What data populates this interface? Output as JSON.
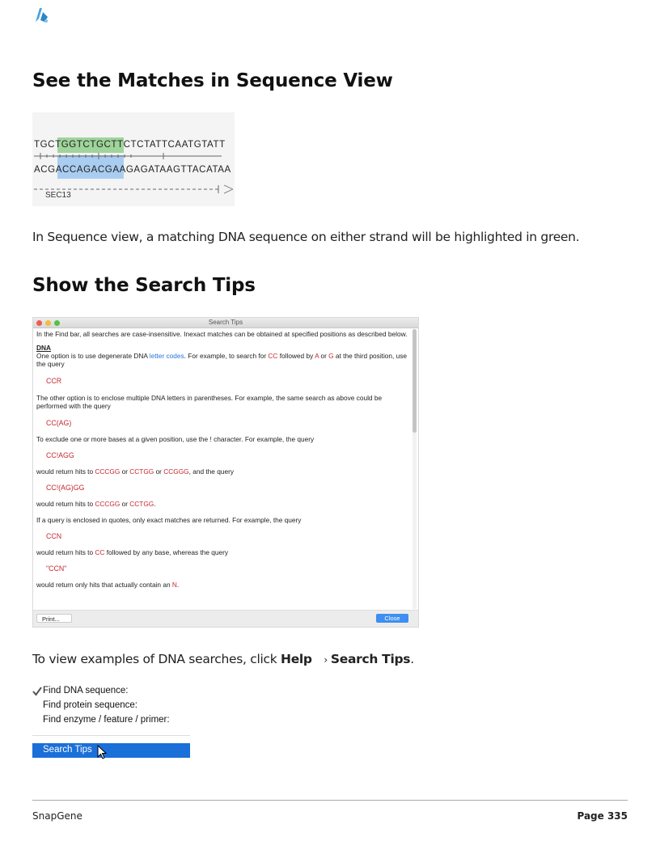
{
  "logo": {
    "icon": "snapgene-logo-icon",
    "color": "#3a9bd9"
  },
  "section1": {
    "heading": "See the Matches in Sequence View"
  },
  "sequence_figure": {
    "top_strand": "TGCTGGTCTGCTTCTCTATTCAATGTATT",
    "bottom_strand": "ACGACCAGACGAAGAGATAAGTTACATAA",
    "feature_label": "SEC13",
    "highlight_top_color": "#9fd49b",
    "highlight_bottom_color": "#a9cdf0"
  },
  "para1": "In Sequence view, a matching DNA sequence on either strand will be highlighted in green.",
  "section2": {
    "heading": "Show the Search Tips"
  },
  "search_tips_window": {
    "title": "Search Tips",
    "intro": "In the Find bar, all searches are case-insensitive. Inexact matches can be obtained at specified positions as described below.",
    "dna_heading": "DNA",
    "p1_a": "One option is to use degenerate DNA ",
    "p1_link": "letter codes",
    "p1_b": ". For example, to search for ",
    "p1_cc": "CC",
    "p1_c": " followed by ",
    "p1_a_base": "A",
    "p1_d": " or ",
    "p1_g_base": "G",
    "p1_e": " at the third position, use the query",
    "q1": "CCR",
    "p2": "The other option is to enclose multiple DNA letters in parentheses. For example, the same search as above could be performed with the query",
    "q2": "CC(AG)",
    "p3": "To exclude one or more bases at a given position, use the ! character. For example, the query",
    "q3": "CC!AGG",
    "p4_a": "would return hits to ",
    "p4_h1": "CCCGG",
    "p4_b": " or ",
    "p4_h2": "CCTGG",
    "p4_c": " or ",
    "p4_h3": "CCGGG",
    "p4_d": ", and the query",
    "q4": "CC!(AG)GG",
    "p5_a": "would return hits to ",
    "p5_h1": "CCCGG",
    "p5_b": " or ",
    "p5_h2": "CCTGG",
    "p5_c": ".",
    "p6": "If a query is enclosed in quotes, only exact matches are returned. For example, the query",
    "q5": "CCN",
    "p7_a": "would return hits to ",
    "p7_h1": "CC",
    "p7_b": " followed by any base, whereas the query",
    "q6": "\"CCN\"",
    "p8_a": "would return only hits that actually contain an ",
    "p8_h1": "N",
    "p8_b": ".",
    "print_button": "Print...",
    "close_button": "Close"
  },
  "para2": {
    "a": "To view examples of DNA searches, click ",
    "help": "Help",
    "arrow": "›",
    "tips": "Search Tips",
    "end": "."
  },
  "menu": {
    "item1": "Find DNA sequence:",
    "item2": "Find protein sequence:",
    "item3": "Find enzyme / feature / primer:",
    "selected": "Search Tips",
    "check_icon": "checkmark-icon"
  },
  "footer": {
    "left": "SnapGene",
    "right": "Page 335"
  }
}
